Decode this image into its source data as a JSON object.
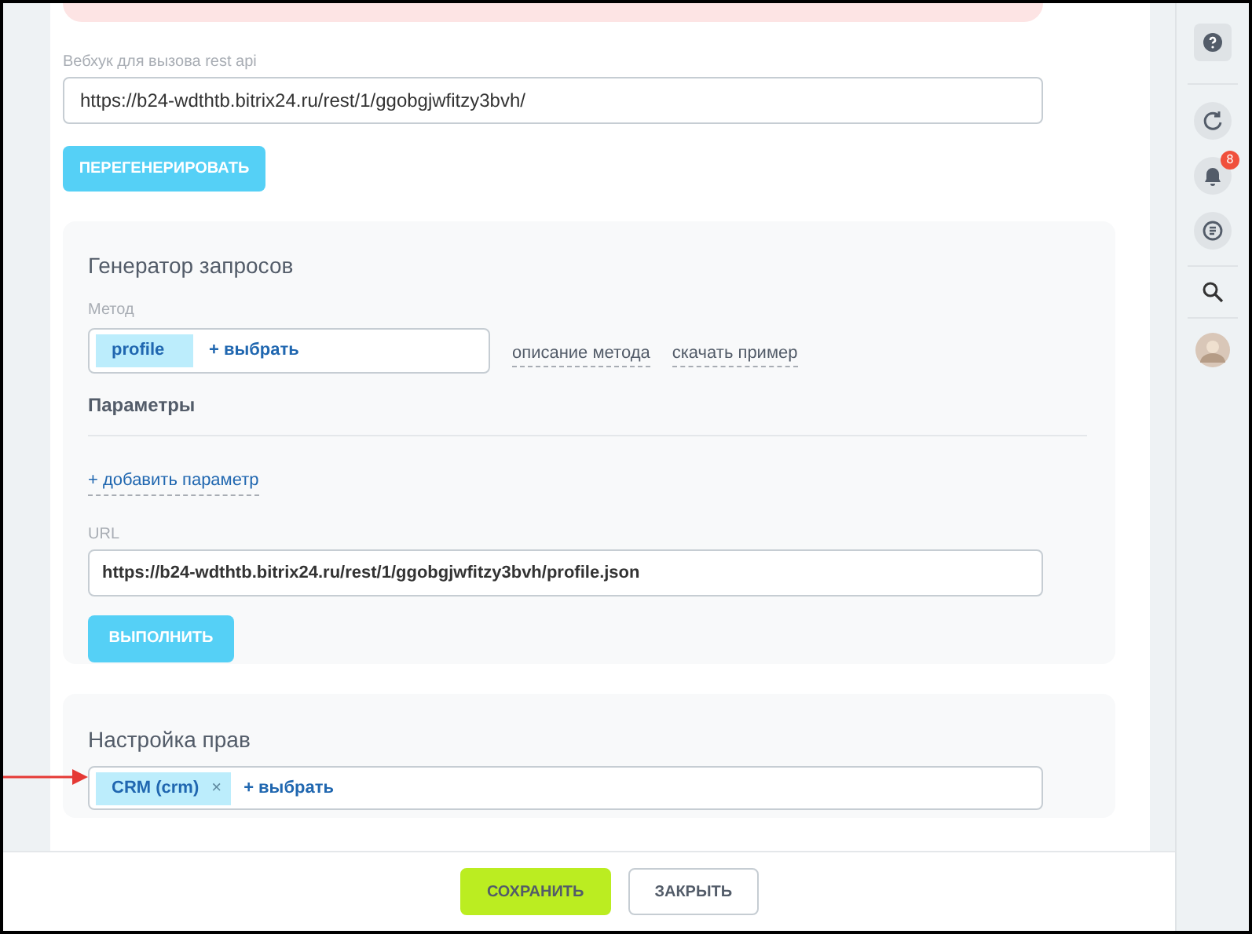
{
  "webhook": {
    "label": "Вебхук для вызова rest api",
    "value": "https://b24-wdthtb.bitrix24.ru/rest/1/ggobgjwfitzy3bvh/",
    "button": "ПЕРЕГЕНЕРИРОВАТЬ"
  },
  "generator": {
    "title": "Генератор запросов",
    "method_label": "Метод",
    "method_tag": "profile",
    "select_link": "+ выбрать",
    "links": [
      "описание метода",
      "скачать пример"
    ],
    "params_title": "Параметры",
    "add_param": "+ добавить параметр",
    "url_label": "URL",
    "url_value": "https://b24-wdthtb.bitrix24.ru/rest/1/ggobgjwfitzy3bvh/profile.json",
    "run_button": "ВЫПОЛНИТЬ"
  },
  "rights": {
    "title": "Настройка прав",
    "tags": [
      {
        "label": "CRM (crm)",
        "remove": "×"
      }
    ],
    "select_link": "+ выбрать"
  },
  "footer": {
    "buttons": [
      {
        "label": "СОХРАНИТЬ",
        "kind": "primary"
      },
      {
        "label": "ЗАКРЫТЬ",
        "kind": "secondary"
      }
    ]
  },
  "sidebar": {
    "notification_count": "8"
  }
}
